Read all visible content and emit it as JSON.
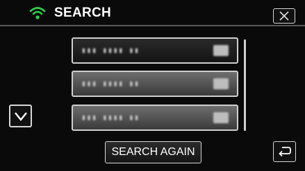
{
  "header": {
    "title": "SEARCH",
    "status_icon": "wifi-icon",
    "close_icon": "close-icon"
  },
  "results": {
    "items": [
      {
        "name": "▮▮▮ ▮▮▮▮ ▮▮",
        "state": "selected"
      },
      {
        "name": "▮▮▮ ▮▮▮▮ ▮▮",
        "state": "normal"
      },
      {
        "name": "▮▮▮ ▮▮▮▮ ▮▮",
        "state": "normal"
      }
    ]
  },
  "navigation": {
    "scroll_down_icon": "chevron-down-icon",
    "back_icon": "return-icon"
  },
  "footer": {
    "search_again_label": "SEARCH AGAIN"
  },
  "colors": {
    "background": "#0a0a0a",
    "accent_wifi": "#2fd24a",
    "border": "#d8d8d8"
  }
}
